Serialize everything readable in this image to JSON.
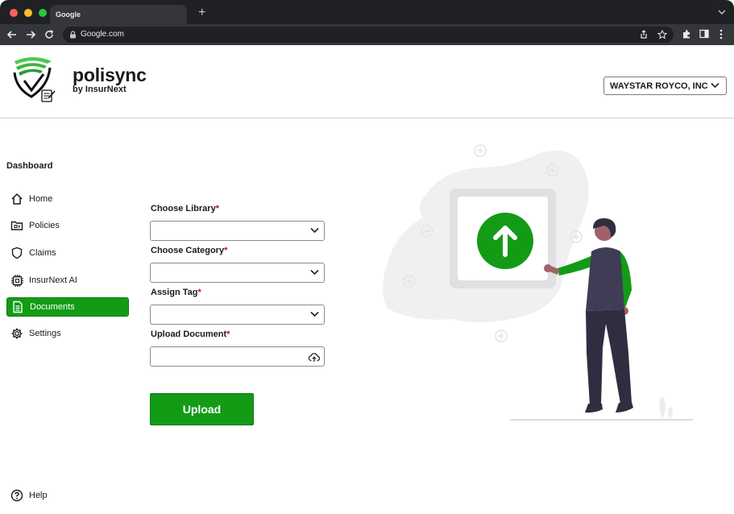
{
  "browser": {
    "tab_title": "Google",
    "new_tab_symbol": "+",
    "url": "Google.com",
    "traffic_lights": [
      "#ff5f57",
      "#febc2e",
      "#28c840"
    ]
  },
  "header": {
    "brand_name": "polisync",
    "brand_sub": "by InsurNext",
    "organization": "WAYSTAR ROYCO, INC"
  },
  "sidebar": {
    "title": "Dashboard",
    "items": [
      {
        "label": "Home",
        "icon": "home-icon",
        "active": false
      },
      {
        "label": "Policies",
        "icon": "folder-icon",
        "active": false
      },
      {
        "label": "Claims",
        "icon": "shield-icon",
        "active": false
      },
      {
        "label": "InsurNext AI",
        "icon": "chip-icon",
        "active": false
      },
      {
        "label": "Documents",
        "icon": "document-icon",
        "active": true
      },
      {
        "label": "Settings",
        "icon": "gear-icon",
        "active": false
      }
    ],
    "help_label": "Help"
  },
  "form": {
    "library_label": "Choose Library",
    "category_label": "Choose Category",
    "tag_label": "Assign Tag",
    "document_label": "Upload Document",
    "required_mark": "*",
    "library_value": "",
    "category_value": "",
    "tag_value": "",
    "document_value": "",
    "upload_button": "Upload"
  },
  "colors": {
    "accent": "#139b16",
    "required": "#d0021b",
    "chrome_dark": "#202124"
  }
}
